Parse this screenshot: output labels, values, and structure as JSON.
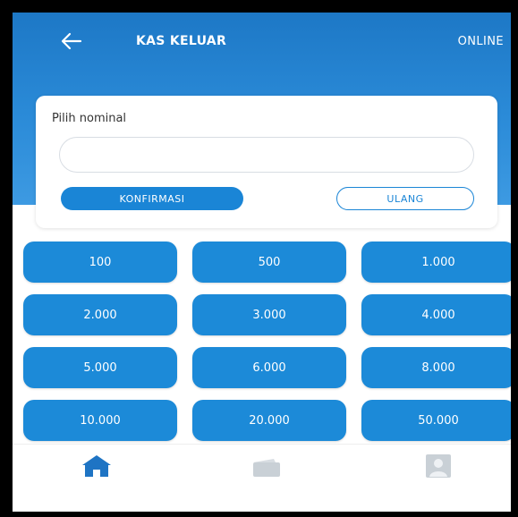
{
  "header": {
    "title": "KAS KELUAR",
    "status": "ONLINE"
  },
  "form": {
    "label": "Pilih nominal",
    "input_value": "",
    "input_placeholder": "",
    "confirm_label": "KONFIRMASI",
    "reset_label": "ULANG"
  },
  "amounts": [
    "100",
    "500",
    "1.000",
    "2.000",
    "3.000",
    "4.000",
    "5.000",
    "6.000",
    "8.000",
    "10.000",
    "20.000",
    "50.000"
  ],
  "nav": {
    "items": [
      {
        "icon": "home-icon",
        "active": true
      },
      {
        "icon": "wallet-icon",
        "active": false
      },
      {
        "icon": "profile-icon",
        "active": false
      }
    ]
  },
  "colors": {
    "primary": "#1c8ad8",
    "header_top": "#1d78c6",
    "nav_active": "#1e74c4",
    "nav_inactive": "#c9d0d6"
  }
}
